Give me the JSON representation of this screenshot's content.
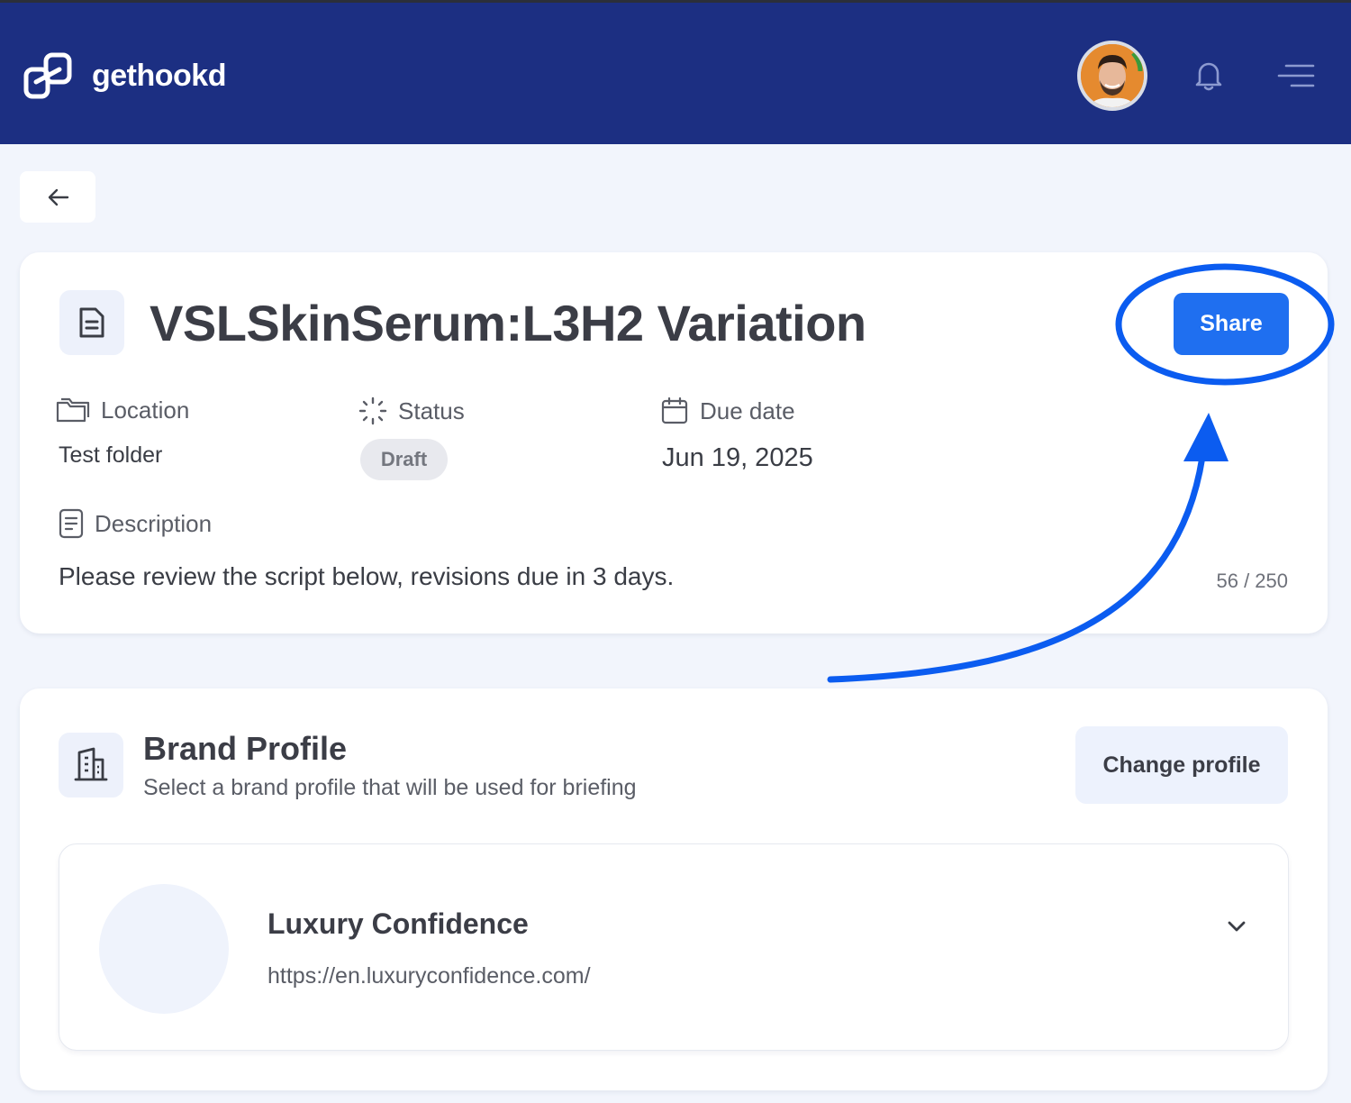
{
  "app": {
    "name": "gethookd"
  },
  "header": {
    "avatar_icon": "user-avatar",
    "notification_icon": "bell-icon",
    "menu_icon": "menu-icon"
  },
  "back_button": {
    "icon": "arrow-left-icon"
  },
  "script": {
    "title": "VSLSkinSerum:L3H2 Variation",
    "share_label": "Share",
    "location": {
      "label": "Location",
      "value": "Test folder"
    },
    "status": {
      "label": "Status",
      "value": "Draft"
    },
    "due_date": {
      "label": "Due date",
      "value": "Jun 19, 2025"
    },
    "description": {
      "label": "Description",
      "text": "Please review the script below, revisions due in 3 days.",
      "counter": "56 / 250"
    }
  },
  "brand_profile": {
    "title": "Brand Profile",
    "subtitle": "Select a brand profile that will be used for briefing",
    "change_label": "Change profile",
    "selected": {
      "name": "Luxury Confidence",
      "url": "https://en.luxuryconfidence.com/"
    }
  },
  "colors": {
    "header_bg": "#1c2f82",
    "accent": "#1f6ff0",
    "annotation": "#0b5cf0",
    "page_bg": "#f2f5fc"
  }
}
